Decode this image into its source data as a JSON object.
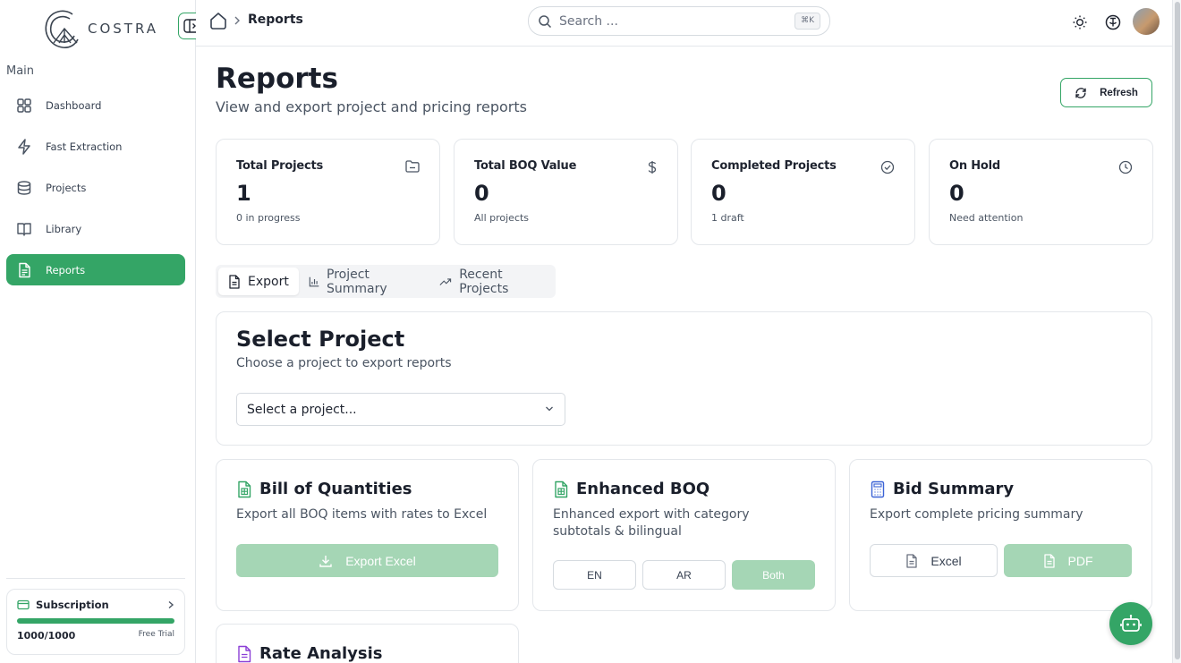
{
  "brand": {
    "name": "COSTRA"
  },
  "sidebar": {
    "section": "Main",
    "items": [
      {
        "label": "Dashboard",
        "icon": "grid-icon"
      },
      {
        "label": "Fast Extraction",
        "icon": "lightning-icon"
      },
      {
        "label": "Projects",
        "icon": "database-icon"
      },
      {
        "label": "Library",
        "icon": "book-icon"
      },
      {
        "label": "Reports",
        "icon": "file-report-icon",
        "active": true
      }
    ],
    "subscription": {
      "label": "Subscription",
      "usage": "1000/1000",
      "progress_fraction": 1.0,
      "plan": "Free Trial"
    }
  },
  "topbar": {
    "breadcrumb": "Reports",
    "search_placeholder": "Search ...",
    "search_shortcut": "⌘K"
  },
  "page": {
    "title": "Reports",
    "subtitle": "View and export project and pricing reports",
    "refresh_label": "Refresh"
  },
  "stats": [
    {
      "label": "Total Projects",
      "value": "1",
      "note": "0 in progress",
      "icon": "folder-icon"
    },
    {
      "label": "Total BOQ Value",
      "value": "0",
      "note": "All projects",
      "icon": "dollar-icon"
    },
    {
      "label": "Completed Projects",
      "value": "0",
      "note": "1 draft",
      "icon": "check-circle-icon"
    },
    {
      "label": "On Hold",
      "value": "0",
      "note": "Need attention",
      "icon": "clock-icon"
    }
  ],
  "tabs": [
    {
      "label": "Export",
      "icon": "file-icon",
      "active": true
    },
    {
      "label": "Project Summary",
      "icon": "bar-chart-icon"
    },
    {
      "label": "Recent Projects",
      "icon": "trending-up-icon"
    }
  ],
  "select_project": {
    "title": "Select Project",
    "description": "Choose a project to export reports",
    "select_value": "Select a project..."
  },
  "exports": {
    "boq": {
      "title": "Bill of Quantities",
      "description": "Export all BOQ items with rates to Excel",
      "button": "Export Excel"
    },
    "enhanced": {
      "title": "Enhanced BOQ",
      "description": "Enhanced export with category subtotals & bilingual",
      "options": [
        "EN",
        "AR",
        "Both"
      ]
    },
    "bid": {
      "title": "Bid Summary",
      "description": "Export complete pricing summary",
      "excel": "Excel",
      "pdf": "PDF"
    },
    "rate": {
      "title": "Rate Analysis"
    }
  },
  "colors": {
    "accent": "#34a566",
    "accent_light": "#a5d6b5",
    "border": "#e4e7eb"
  }
}
